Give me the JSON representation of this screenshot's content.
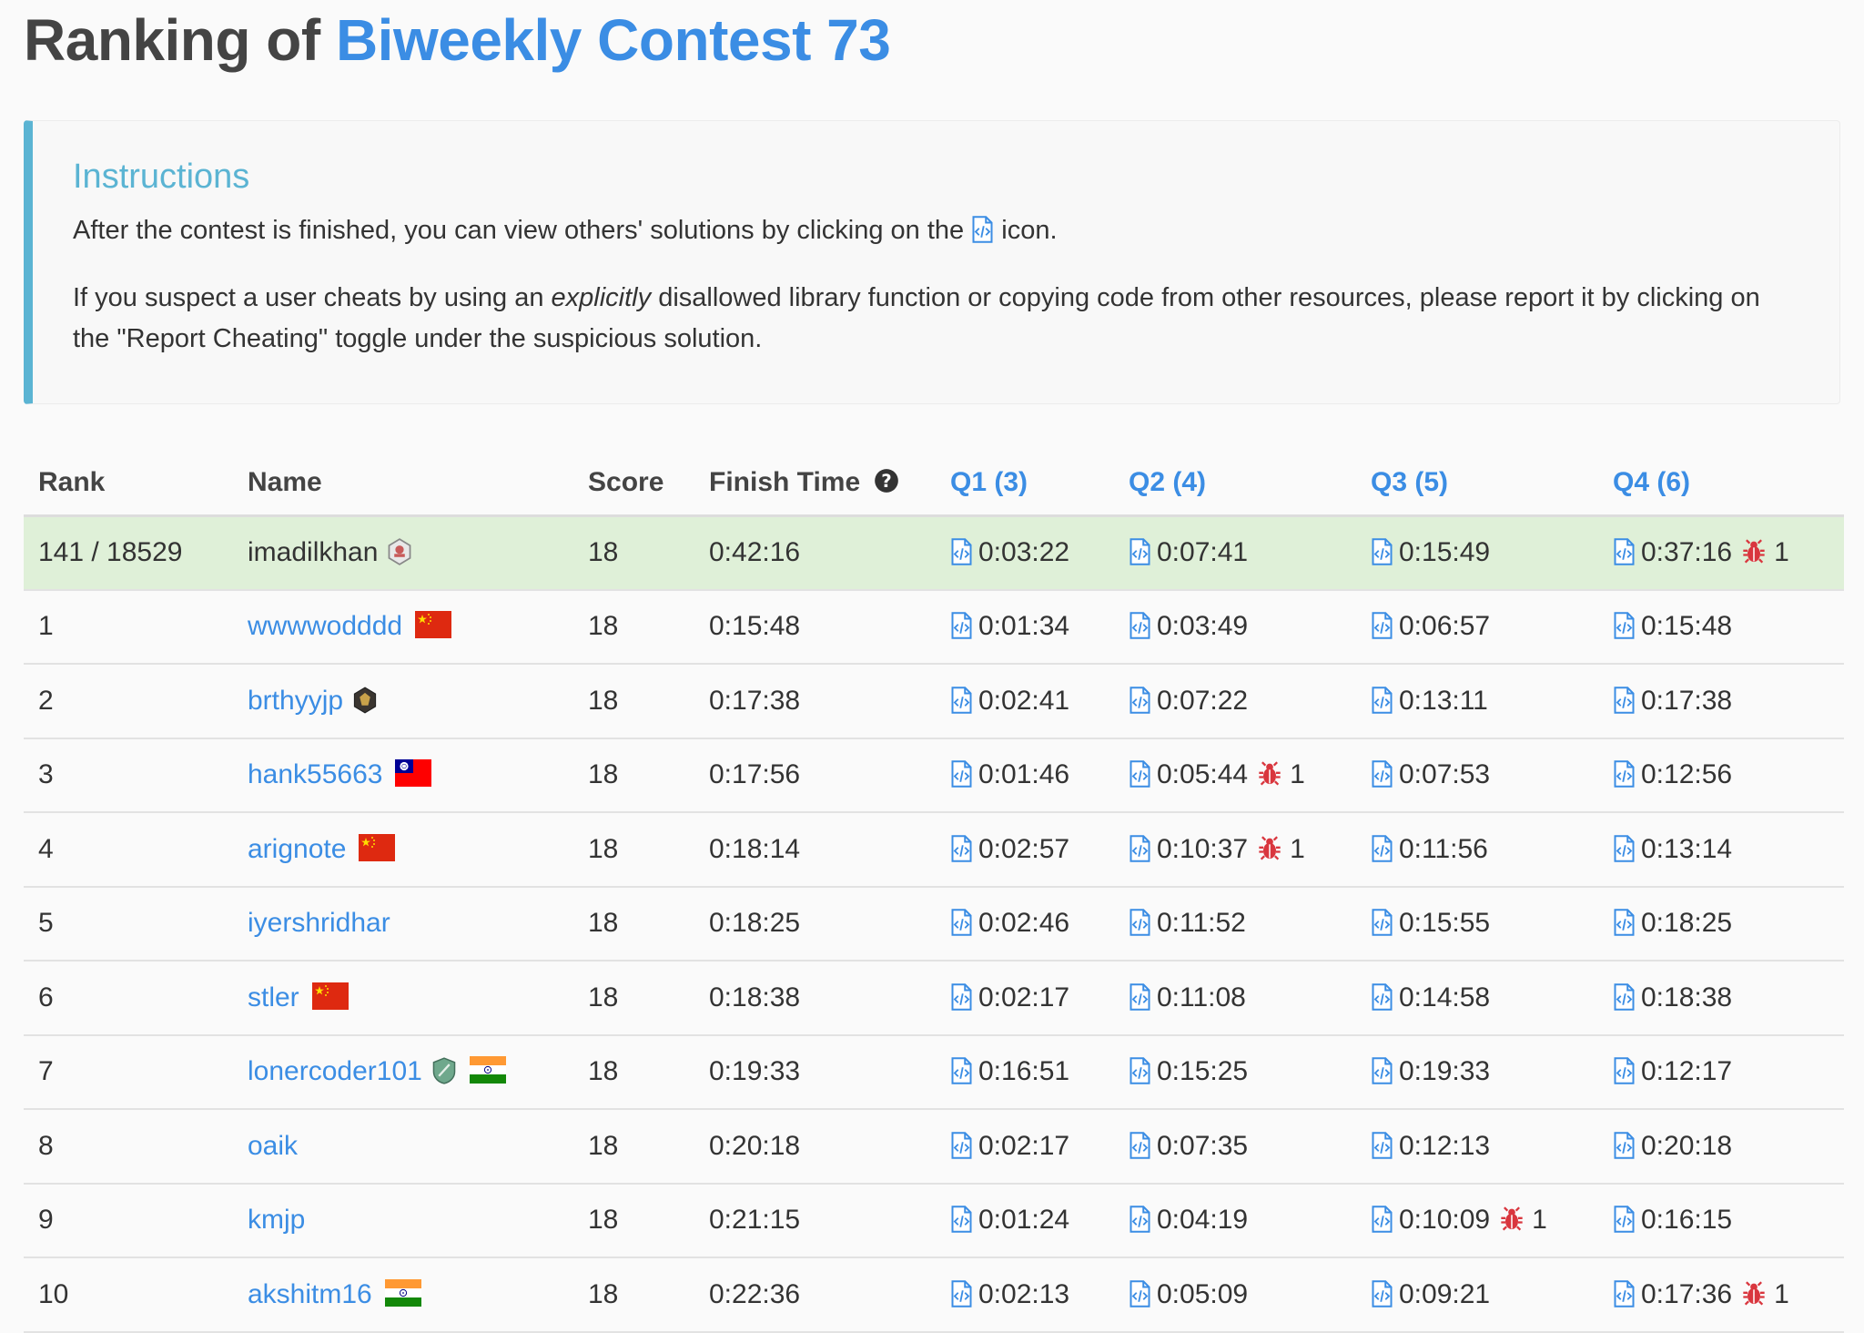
{
  "title": {
    "prefix": "Ranking of",
    "contest": "Biweekly Contest 73"
  },
  "instructions": {
    "heading": "Instructions",
    "line1_before": "After the contest is finished, you can view others' solutions by clicking on the",
    "line1_after": "icon.",
    "line2_before": "If you suspect a user cheats by using an",
    "line2_em": "explicitly",
    "line2_after": "disallowed library function or copying code from other resources, please report it by clicking on the \"Report Cheating\" toggle under the suspicious solution."
  },
  "columns": {
    "rank": "Rank",
    "name": "Name",
    "score": "Score",
    "finish": "Finish Time",
    "q1": "Q1 (3)",
    "q2": "Q2 (4)",
    "q3": "Q3 (5)",
    "q4": "Q4 (6)"
  },
  "colors": {
    "accent": "#3b8de4",
    "bug": "#d9363e",
    "highlight_row": "#dff0d8",
    "info": "#5bb4d3"
  },
  "rows": [
    {
      "rank": "141 / 18529",
      "name": "imadilkhan",
      "link": false,
      "badge": "contest-badge-icon",
      "flag": "",
      "score": "18",
      "finish": "0:42:16",
      "q": [
        {
          "t": "0:03:22",
          "bug": ""
        },
        {
          "t": "0:07:41",
          "bug": ""
        },
        {
          "t": "0:15:49",
          "bug": ""
        },
        {
          "t": "0:37:16",
          "bug": "1"
        }
      ]
    },
    {
      "rank": "1",
      "name": "wwwwodddd",
      "link": true,
      "badge": "",
      "flag": "cn",
      "score": "18",
      "finish": "0:15:48",
      "q": [
        {
          "t": "0:01:34",
          "bug": ""
        },
        {
          "t": "0:03:49",
          "bug": ""
        },
        {
          "t": "0:06:57",
          "bug": ""
        },
        {
          "t": "0:15:48",
          "bug": ""
        }
      ]
    },
    {
      "rank": "2",
      "name": "brthyyjp",
      "link": true,
      "badge": "guardian-badge-icon",
      "flag": "",
      "score": "18",
      "finish": "0:17:38",
      "q": [
        {
          "t": "0:02:41",
          "bug": ""
        },
        {
          "t": "0:07:22",
          "bug": ""
        },
        {
          "t": "0:13:11",
          "bug": ""
        },
        {
          "t": "0:17:38",
          "bug": ""
        }
      ]
    },
    {
      "rank": "3",
      "name": "hank55663",
      "link": true,
      "badge": "",
      "flag": "tw",
      "score": "18",
      "finish": "0:17:56",
      "q": [
        {
          "t": "0:01:46",
          "bug": ""
        },
        {
          "t": "0:05:44",
          "bug": "1"
        },
        {
          "t": "0:07:53",
          "bug": ""
        },
        {
          "t": "0:12:56",
          "bug": ""
        }
      ]
    },
    {
      "rank": "4",
      "name": "arignote",
      "link": true,
      "badge": "",
      "flag": "cn",
      "score": "18",
      "finish": "0:18:14",
      "q": [
        {
          "t": "0:02:57",
          "bug": ""
        },
        {
          "t": "0:10:37",
          "bug": "1"
        },
        {
          "t": "0:11:56",
          "bug": ""
        },
        {
          "t": "0:13:14",
          "bug": ""
        }
      ]
    },
    {
      "rank": "5",
      "name": "iyershridhar",
      "link": true,
      "badge": "",
      "flag": "",
      "score": "18",
      "finish": "0:18:25",
      "q": [
        {
          "t": "0:02:46",
          "bug": ""
        },
        {
          "t": "0:11:52",
          "bug": ""
        },
        {
          "t": "0:15:55",
          "bug": ""
        },
        {
          "t": "0:18:25",
          "bug": ""
        }
      ]
    },
    {
      "rank": "6",
      "name": "stler",
      "link": true,
      "badge": "",
      "flag": "cn",
      "score": "18",
      "finish": "0:18:38",
      "q": [
        {
          "t": "0:02:17",
          "bug": ""
        },
        {
          "t": "0:11:08",
          "bug": ""
        },
        {
          "t": "0:14:58",
          "bug": ""
        },
        {
          "t": "0:18:38",
          "bug": ""
        }
      ]
    },
    {
      "rank": "7",
      "name": "lonercoder101",
      "link": true,
      "badge": "knight-badge-icon",
      "flag": "in",
      "score": "18",
      "finish": "0:19:33",
      "q": [
        {
          "t": "0:16:51",
          "bug": ""
        },
        {
          "t": "0:15:25",
          "bug": ""
        },
        {
          "t": "0:19:33",
          "bug": ""
        },
        {
          "t": "0:12:17",
          "bug": ""
        }
      ]
    },
    {
      "rank": "8",
      "name": "oaik",
      "link": true,
      "badge": "",
      "flag": "",
      "score": "18",
      "finish": "0:20:18",
      "q": [
        {
          "t": "0:02:17",
          "bug": ""
        },
        {
          "t": "0:07:35",
          "bug": ""
        },
        {
          "t": "0:12:13",
          "bug": ""
        },
        {
          "t": "0:20:18",
          "bug": ""
        }
      ]
    },
    {
      "rank": "9",
      "name": "kmjp",
      "link": true,
      "badge": "",
      "flag": "",
      "score": "18",
      "finish": "0:21:15",
      "q": [
        {
          "t": "0:01:24",
          "bug": ""
        },
        {
          "t": "0:04:19",
          "bug": ""
        },
        {
          "t": "0:10:09",
          "bug": "1"
        },
        {
          "t": "0:16:15",
          "bug": ""
        }
      ]
    },
    {
      "rank": "10",
      "name": "akshitm16",
      "link": true,
      "badge": "",
      "flag": "in",
      "score": "18",
      "finish": "0:22:36",
      "q": [
        {
          "t": "0:02:13",
          "bug": ""
        },
        {
          "t": "0:05:09",
          "bug": ""
        },
        {
          "t": "0:09:21",
          "bug": ""
        },
        {
          "t": "0:17:36",
          "bug": "1"
        }
      ]
    }
  ]
}
